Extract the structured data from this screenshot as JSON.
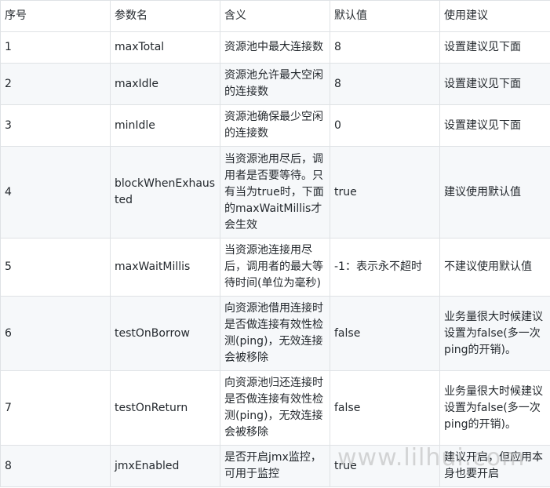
{
  "table": {
    "headers": [
      "序号",
      "参数名",
      "含义",
      "默认值",
      "使用建议"
    ],
    "rows": [
      [
        "1",
        "maxTotal",
        "资源池中最大连接数",
        "8",
        "设置建议见下面"
      ],
      [
        "2",
        "maxIdle",
        "资源池允许最大空闲的连接数",
        "8",
        "设置建议见下面"
      ],
      [
        "3",
        "minIdle",
        "资源池确保最少空闲的连接数",
        "0",
        "设置建议见下面"
      ],
      [
        "4",
        "blockWhenExhausted",
        "当资源池用尽后，调用者是否要等待。只有当为true时，下面的maxWaitMillis才会生效",
        "true",
        "建议使用默认值"
      ],
      [
        "5",
        "maxWaitMillis",
        "当资源池连接用尽后，调用者的最大等待时间(单位为毫秒)",
        "-1：表示永不超时",
        "不建议使用默认值"
      ],
      [
        "6",
        "testOnBorrow",
        "向资源池借用连接时是否做连接有效性检测(ping)，无效连接会被移除",
        "false",
        "业务量很大时候建议设置为false(多一次ping的开销)。"
      ],
      [
        "7",
        "testOnReturn",
        "向资源池归还连接时是否做连接有效性检测(ping)，无效连接会被移除",
        "false",
        "业务量很大时候建议设置为false(多一次ping的开销)。"
      ],
      [
        "8",
        "jmxEnabled",
        "是否开启jmx监控，可用于监控",
        "true",
        "建议开启，但应用本身也要开启"
      ]
    ]
  },
  "watermark": "www.lilhui.com"
}
